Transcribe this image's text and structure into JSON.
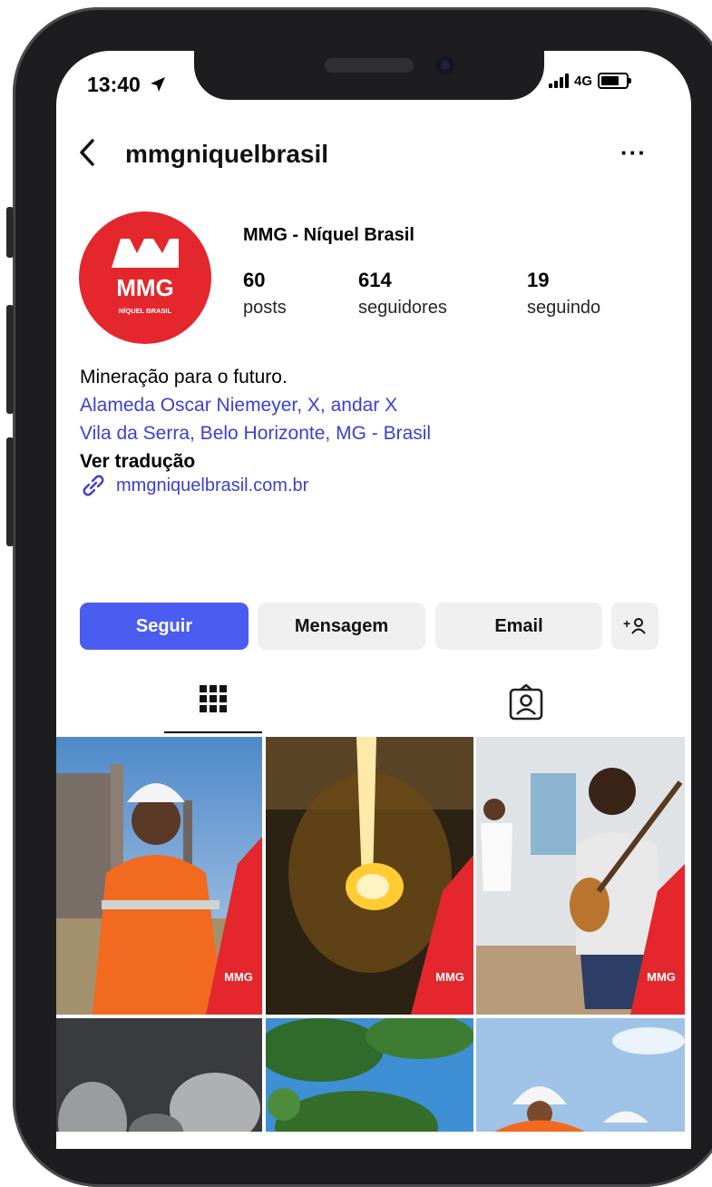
{
  "status_bar": {
    "time": "13:40",
    "network": "4G"
  },
  "header": {
    "username": "mmgniquelbrasil",
    "more": "···"
  },
  "profile": {
    "display_name": "MMG - Níquel Brasil",
    "avatar_text": {
      "top": "MMG",
      "bottom": "NÍQUEL BRASIL"
    },
    "stats": [
      {
        "value": "60",
        "label": "posts"
      },
      {
        "value": "614",
        "label": "seguidores"
      },
      {
        "value": "19",
        "label": "seguindo"
      }
    ],
    "bio": {
      "line1": "Mineração para o futuro.",
      "line2": "Alameda Oscar Niemeyer, X, andar X",
      "line3": "Vila da Serra, Belo Horizonte, MG - Brasil",
      "translate": "Ver tradução"
    },
    "website": "mmgniquelbrasil.com.br"
  },
  "actions": {
    "follow": "Seguir",
    "message": "Mensagem",
    "email": "Email",
    "add_friend": "+"
  },
  "tabs": [
    {
      "name": "grid-icon",
      "active": true
    },
    {
      "name": "tagged-icon",
      "active": false
    }
  ],
  "posts": [
    {
      "subject": "worker in orange uniform at plant",
      "badge": "MMG"
    },
    {
      "subject": "molten metal furnace",
      "badge": "MMG"
    },
    {
      "subject": "students playing guitars",
      "badge": "MMG"
    },
    {
      "subject": "nickel ore pieces"
    },
    {
      "subject": "tree canopy and sky"
    },
    {
      "subject": "workers with helmets"
    }
  ],
  "colors": {
    "brand": "#e3272d",
    "follow": "#4b5cf0",
    "link": "#3b3fd1"
  }
}
